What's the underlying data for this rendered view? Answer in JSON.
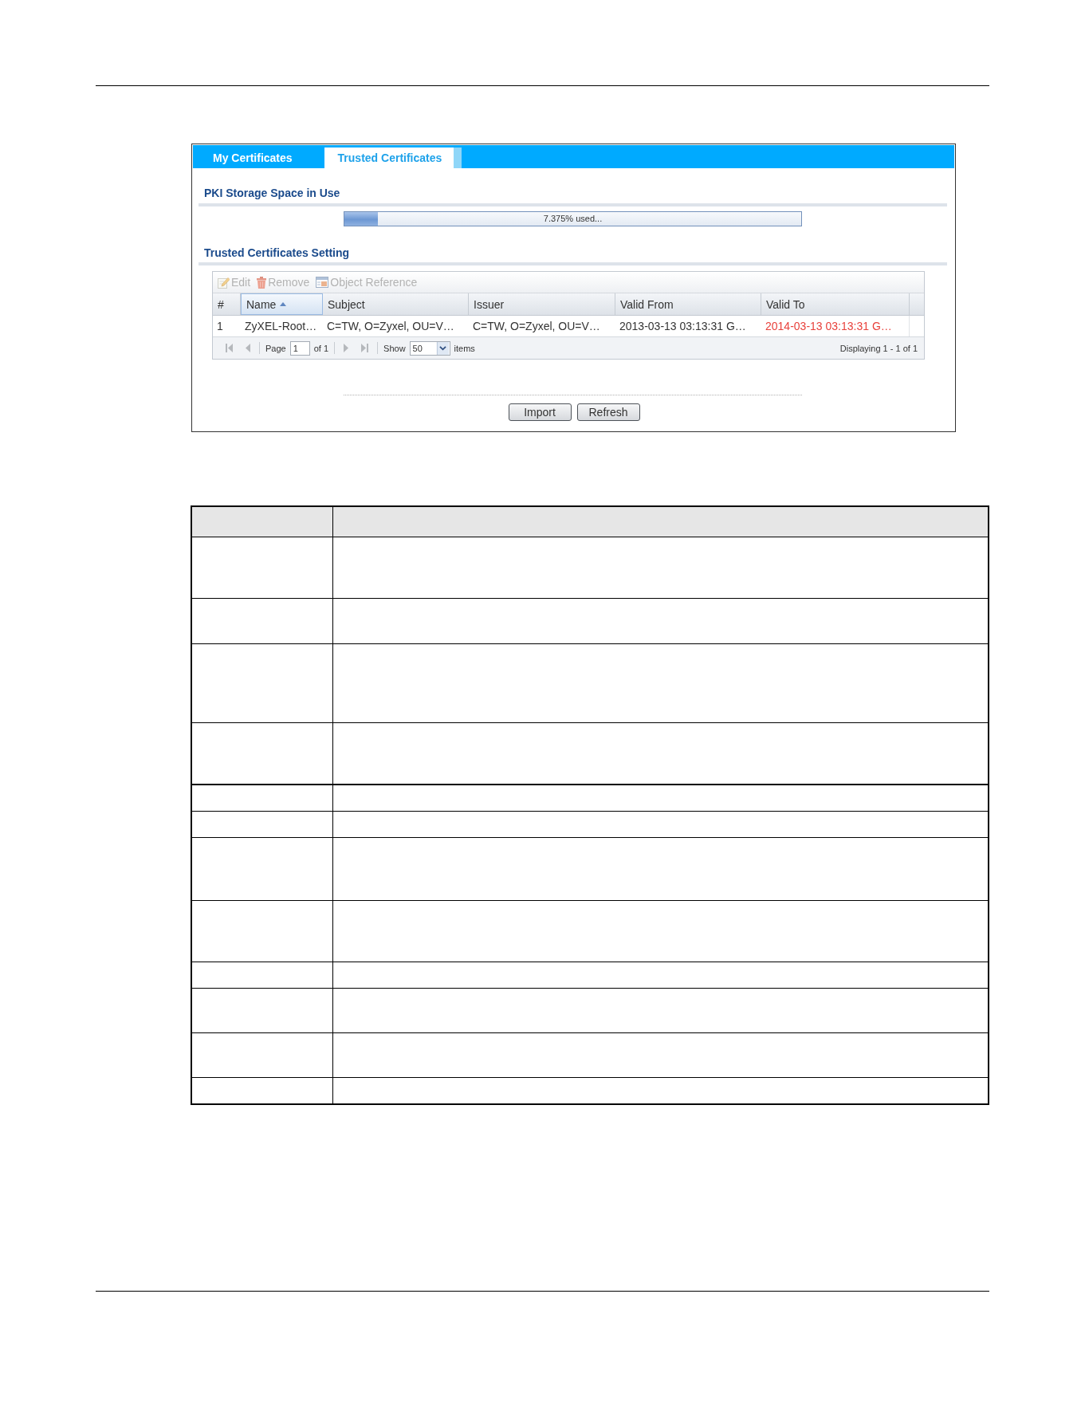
{
  "tabs": [
    {
      "label": "My Certificates",
      "selected": false
    },
    {
      "label": "Trusted Certificates",
      "selected": true
    }
  ],
  "storage": {
    "title": "PKI Storage Space in Use",
    "level": 0.07375,
    "reading": "7.375% used..."
  },
  "setting": {
    "title": "Trusted Certificates Setting",
    "toolbar": [
      {
        "kind": "edit",
        "label": "Edit",
        "disabled": true
      },
      {
        "kind": "remove",
        "label": "Remove",
        "disabled": true
      },
      {
        "kind": "reference",
        "label": "Object Reference",
        "disabled": true
      }
    ],
    "table": {
      "columns": [
        {
          "label": "#",
          "sorted": false
        },
        {
          "label": "Name",
          "sorted": true
        },
        {
          "label": "Subject",
          "sorted": false
        },
        {
          "label": "Issuer",
          "sorted": false
        },
        {
          "label": "Valid From",
          "sorted": false
        },
        {
          "label": "Valid To",
          "sorted": false
        }
      ],
      "rows": [
        {
          "cells": [
            "1",
            "ZyXEL-Root…",
            "C=TW, O=Zyxel, OU=V…",
            "C=TW, O=Zyxel, OU=V…",
            "2013-03-13 03:13:31 G…",
            "2014-03-13 03:13:31 G…"
          ],
          "expired": true
        }
      ]
    },
    "pager": {
      "back": [
        {
          "kind": "first",
          "disabled": true
        },
        {
          "kind": "prev",
          "disabled": true
        }
      ],
      "page_label": "Page",
      "page": "1",
      "page_total": "of 1",
      "forward": [
        {
          "kind": "next",
          "disabled": true
        },
        {
          "kind": "last",
          "disabled": true
        }
      ],
      "show_label": "Show",
      "per_page": "50",
      "items_label": "items",
      "summary": "Displaying 1 - 1 of 1"
    }
  },
  "buttons": [
    {
      "label": "Import"
    },
    {
      "label": "Refresh"
    }
  ]
}
